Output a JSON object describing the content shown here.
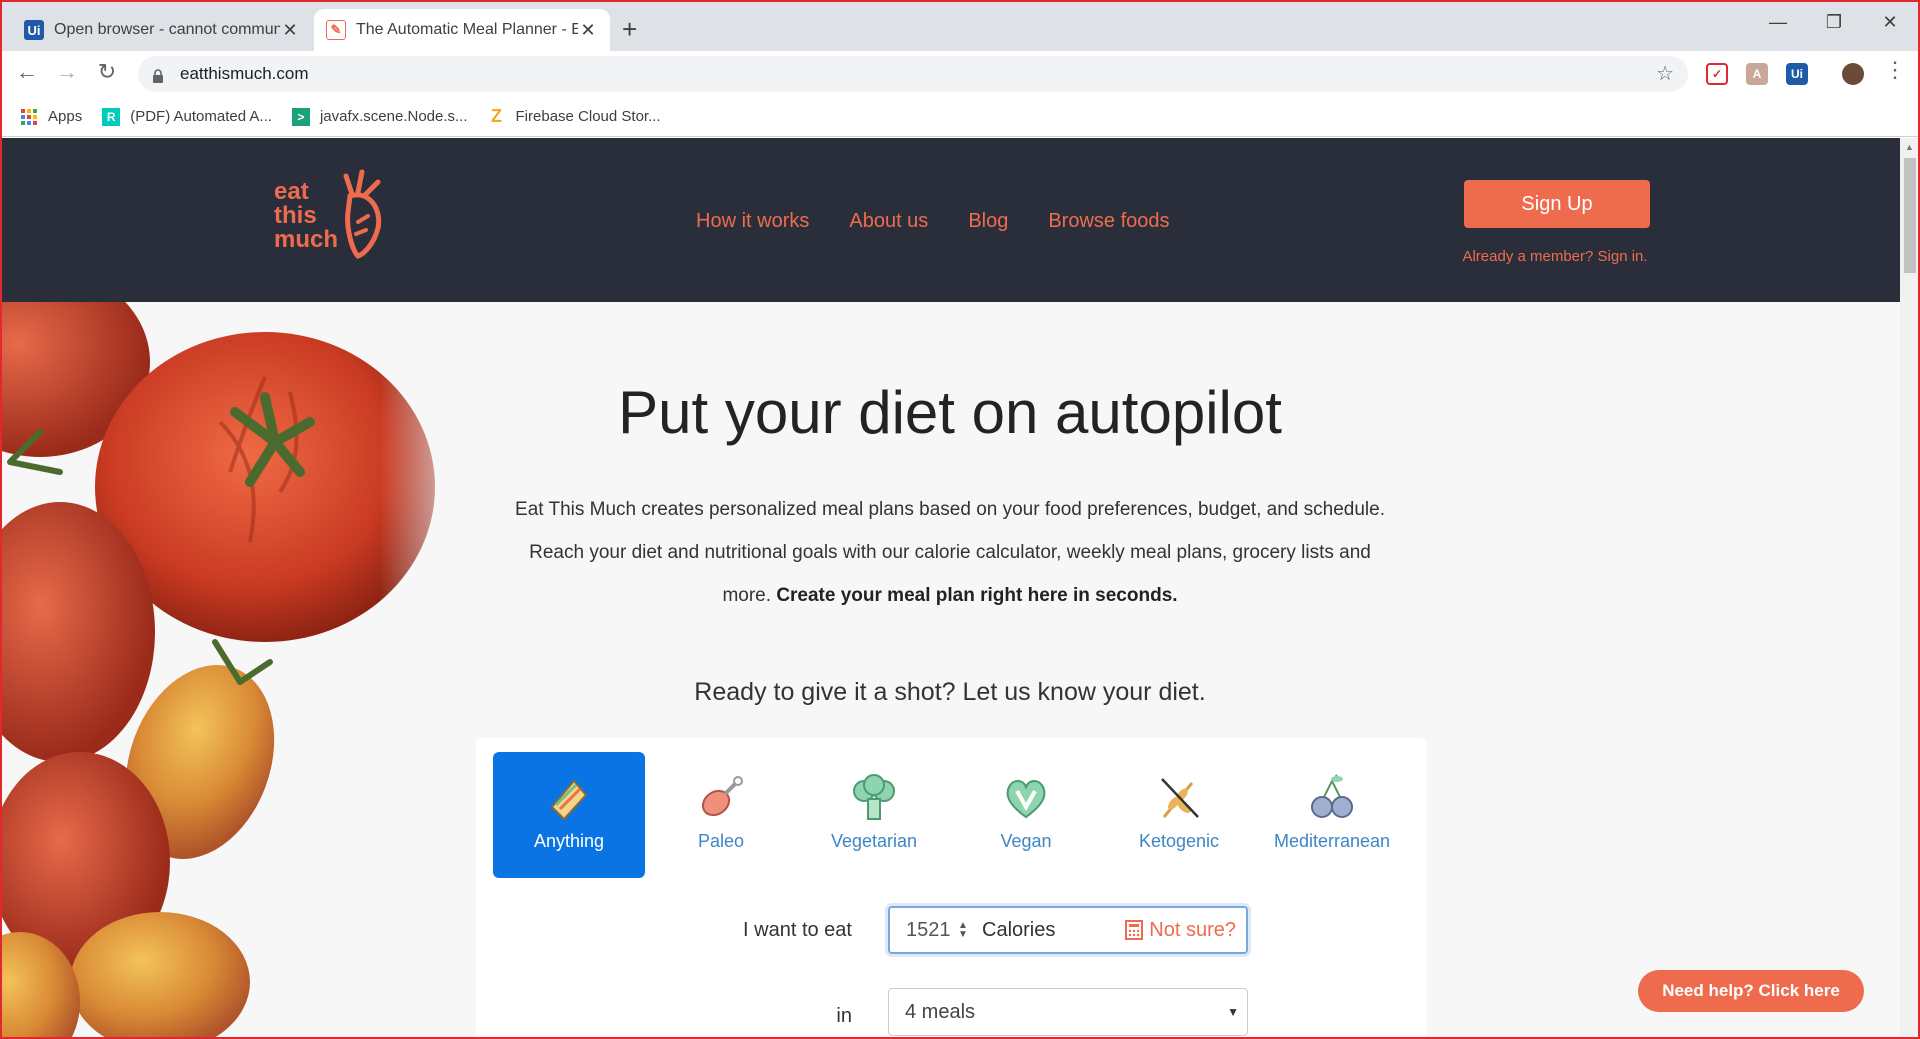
{
  "browser": {
    "tabs": [
      {
        "title": "Open browser - cannot communi",
        "favicon": "uipath-icon"
      },
      {
        "title": "The Automatic Meal Planner - Ea",
        "favicon": "eatthismuch-icon"
      }
    ],
    "url": "eatthismuch.com",
    "bookmarks": [
      {
        "label": "Apps"
      },
      {
        "label": "(PDF) Automated A..."
      },
      {
        "label": "javafx.scene.Node.s..."
      },
      {
        "label": "Firebase Cloud Stor..."
      }
    ]
  },
  "site": {
    "logo_lines": [
      "eat",
      "this",
      "much"
    ],
    "nav": [
      "How it works",
      "About us",
      "Blog",
      "Browse foods"
    ],
    "signup_label": "Sign Up",
    "signin_label": "Already a member? Sign in.",
    "hero_title": "Put your diet on autopilot",
    "hero_line1": "Eat This Much creates personalized meal plans based on your food preferences, budget, and schedule.",
    "hero_line2": "Reach your diet and nutritional goals with our calorie calculator, weekly meal plans, grocery lists and",
    "hero_line3_plain": "more.",
    "hero_line3_bold": "Create your meal plan right here in seconds.",
    "prompt": "Ready to give it a shot? Let us know your diet.",
    "diets": [
      "Anything",
      "Paleo",
      "Vegetarian",
      "Vegan",
      "Ketogenic",
      "Mediterranean"
    ],
    "selected_diet": "Anything",
    "eat_label": "I want to eat",
    "calories_value": "1521",
    "calories_unit": "Calories",
    "not_sure_label": "Not sure?",
    "in_label": "in",
    "meals_value": "4 meals",
    "help_label": "Need help? Click here"
  },
  "colors": {
    "accent": "#ee6c4d",
    "header_bg": "#2a2e3b",
    "selected_diet_bg": "#0b74e5",
    "diet_label": "#3d85c6"
  }
}
